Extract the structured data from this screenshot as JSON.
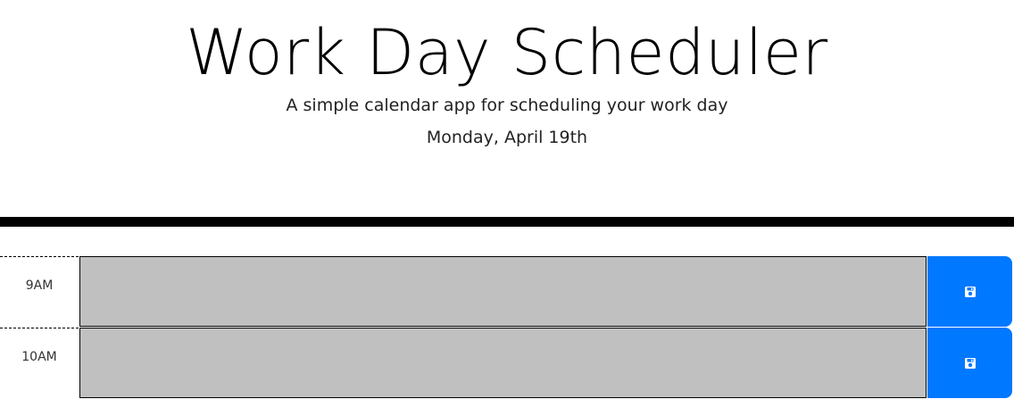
{
  "header": {
    "title": "Work Day Scheduler",
    "subtitle": "A simple calendar app for scheduling your work day",
    "current_day": "Monday, April 19th"
  },
  "time_blocks": [
    {
      "hour": "9AM",
      "description": "",
      "status": "past",
      "save_icon": "floppy-disk-icon"
    },
    {
      "hour": "10AM",
      "description": "",
      "status": "past",
      "save_icon": "floppy-disk-icon"
    }
  ],
  "colors": {
    "past": "#c0c0c0",
    "save_button": "#0078ff",
    "divider": "#000000"
  }
}
